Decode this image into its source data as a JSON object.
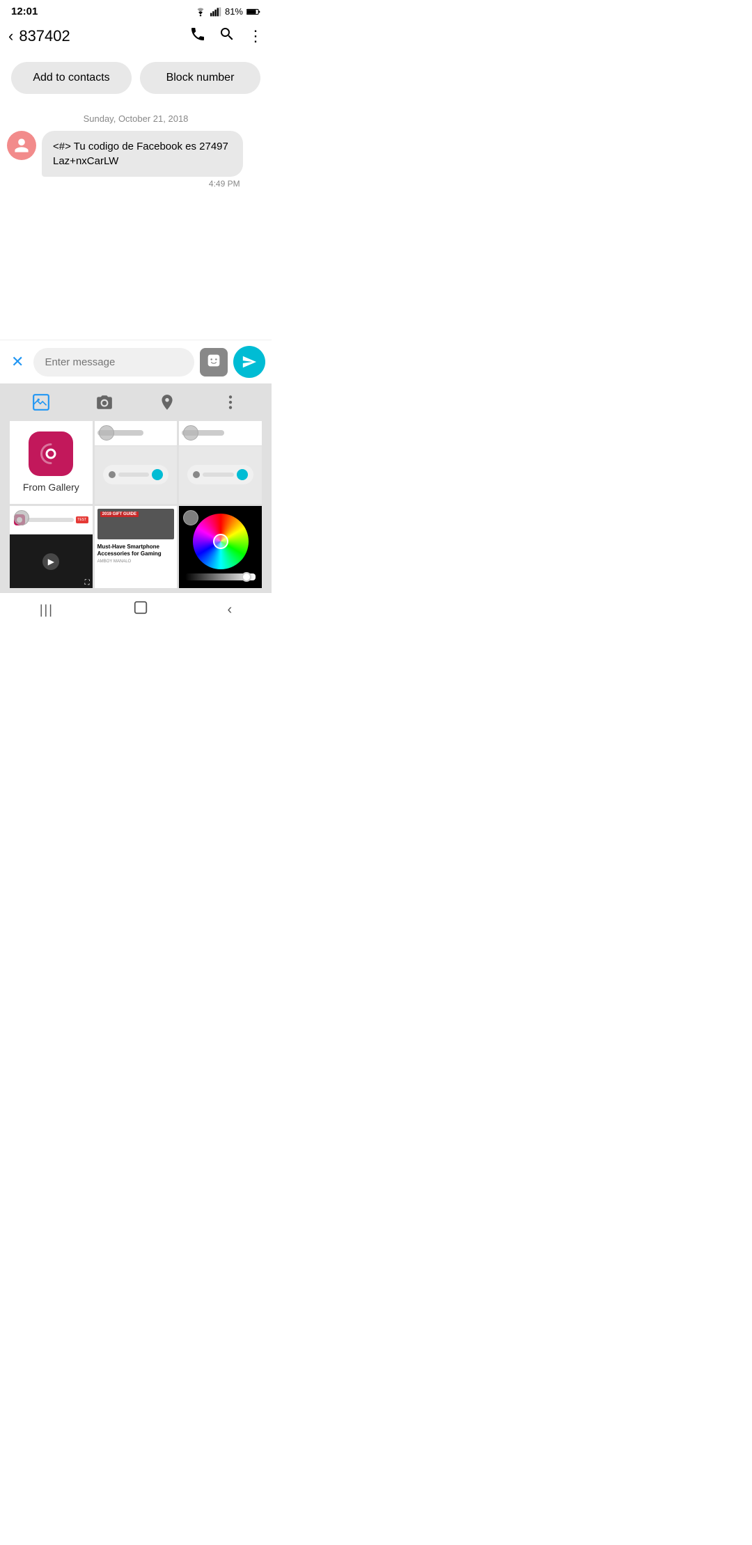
{
  "status": {
    "time": "12:01",
    "battery": "81%"
  },
  "header": {
    "back_label": "‹",
    "contact_number": "837402",
    "phone_icon": "📞",
    "search_icon": "🔍",
    "more_icon": "⋮"
  },
  "actions": {
    "add_to_contacts": "Add to contacts",
    "block_number": "Block number"
  },
  "conversation": {
    "date": "Sunday, October 21, 2018",
    "messages": [
      {
        "from": "other",
        "text": "<#> Tu codigo de Facebook es 27497 Laz+nxCarLW",
        "time": "4:49 PM"
      }
    ]
  },
  "input": {
    "placeholder": "Enter message",
    "close_icon": "✕",
    "sticker_icon": "🎭",
    "send_icon": "➤"
  },
  "media_panel": {
    "gallery_icon": "🖼",
    "camera_icon": "📷",
    "location_icon": "📍",
    "more_icon": "⋮",
    "from_gallery_label": "From Gallery"
  },
  "nav": {
    "recents": "|||",
    "home": "⬜",
    "back": "‹"
  }
}
